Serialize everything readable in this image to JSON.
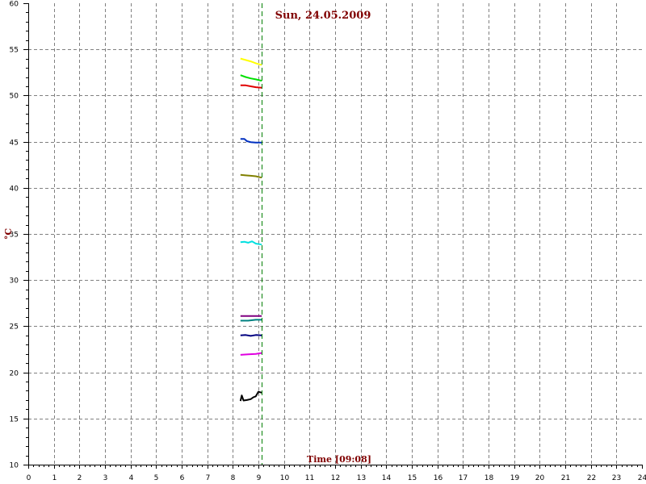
{
  "chart_data": {
    "type": "line",
    "title": "Sun, 24.05.2009",
    "xlabel": "Time [09:08]",
    "ylabel": "°C",
    "xlim": [
      0,
      24
    ],
    "ylim": [
      10,
      60
    ],
    "x_ticks": [
      "0",
      "1",
      "2",
      "3",
      "4",
      "5",
      "6",
      "7",
      "8",
      "9",
      "10",
      "11",
      "12",
      "13",
      "14",
      "15",
      "16",
      "17",
      "18",
      "19",
      "20",
      "21",
      "22",
      "23",
      "24"
    ],
    "y_ticks": [
      "10",
      "15",
      "20",
      "25",
      "30",
      "35",
      "40",
      "45",
      "50",
      "55",
      "60"
    ],
    "grid": true,
    "current_time": 9.13,
    "colors": {
      "title": "#800000",
      "axis_title": "#800000",
      "grid": "#808080",
      "axis": "#000000",
      "marker": "#008000"
    },
    "series": [
      {
        "color": "#ffff00",
        "x": [
          8.3,
          8.5,
          8.7,
          8.9,
          9.13
        ],
        "y": [
          54.0,
          53.85,
          53.7,
          53.5,
          53.3
        ]
      },
      {
        "color": "#00e000",
        "x": [
          8.3,
          8.5,
          8.7,
          8.9,
          9.13
        ],
        "y": [
          52.2,
          52.0,
          51.85,
          51.75,
          51.6
        ]
      },
      {
        "color": "#e00000",
        "x": [
          8.3,
          8.5,
          8.7,
          8.9,
          9.13
        ],
        "y": [
          51.1,
          51.1,
          51.0,
          50.9,
          50.85
        ]
      },
      {
        "color": "#0030c0",
        "x": [
          8.3,
          8.45,
          8.55,
          8.7,
          8.9,
          9.13
        ],
        "y": [
          45.3,
          45.3,
          45.05,
          44.95,
          44.9,
          44.9
        ]
      },
      {
        "color": "#808000",
        "x": [
          8.3,
          8.5,
          8.7,
          8.9,
          9.13
        ],
        "y": [
          41.4,
          41.35,
          41.3,
          41.25,
          41.1
        ]
      },
      {
        "color": "#00e0e0",
        "x": [
          8.3,
          8.45,
          8.6,
          8.75,
          8.9,
          9.13
        ],
        "y": [
          34.1,
          34.15,
          34.05,
          34.2,
          33.95,
          33.85
        ]
      },
      {
        "color": "#800080",
        "x": [
          8.3,
          8.6,
          8.9,
          9.13
        ],
        "y": [
          26.1,
          26.1,
          26.1,
          26.1
        ]
      },
      {
        "color": "#008080",
        "x": [
          8.3,
          8.6,
          8.9,
          9.13
        ],
        "y": [
          25.6,
          25.6,
          25.7,
          25.7
        ]
      },
      {
        "color": "#000080",
        "x": [
          8.3,
          8.5,
          8.7,
          8.9,
          9.13
        ],
        "y": [
          24.0,
          24.05,
          23.95,
          24.05,
          24.0
        ]
      },
      {
        "color": "#e000e0",
        "x": [
          8.3,
          8.6,
          8.9,
          9.13
        ],
        "y": [
          21.9,
          21.95,
          22.0,
          22.1
        ]
      },
      {
        "color": "#000000",
        "x": [
          8.3,
          8.35,
          8.42,
          8.55,
          8.7,
          8.8,
          8.9,
          9.0,
          9.13
        ],
        "y": [
          16.9,
          17.5,
          16.95,
          17.0,
          17.1,
          17.3,
          17.4,
          17.9,
          17.8
        ]
      }
    ]
  }
}
